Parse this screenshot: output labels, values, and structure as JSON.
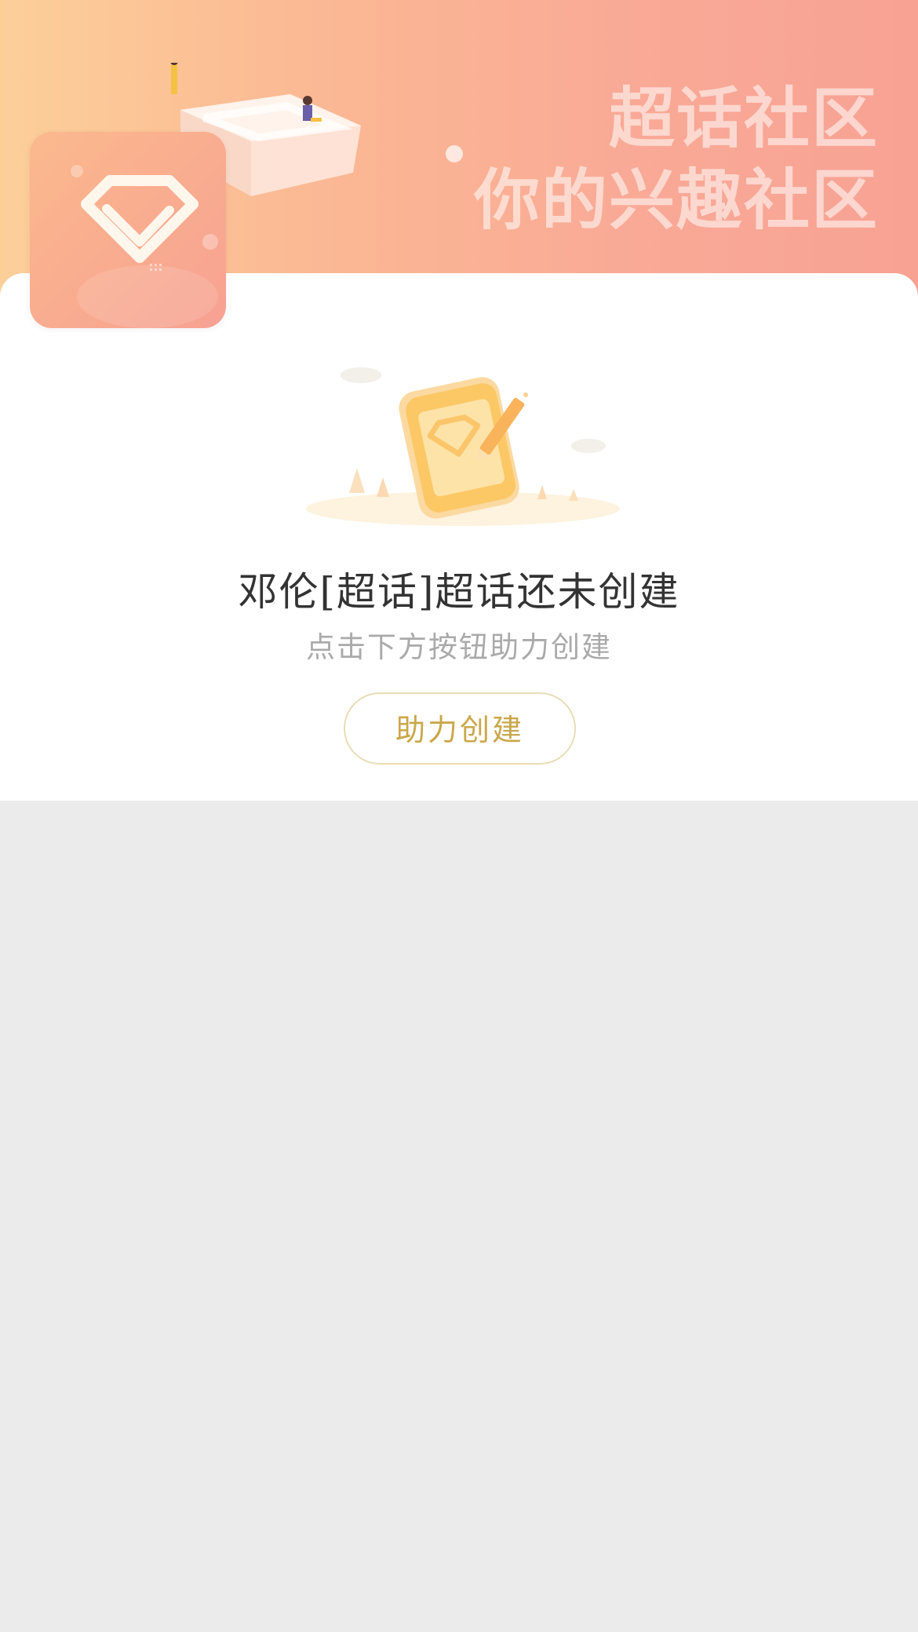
{
  "banner": {
    "slogan_line1": "超话社区",
    "slogan_line2": "你的兴趣社区"
  },
  "avatar": {
    "icon": "diamond-icon"
  },
  "empty_state": {
    "title": "邓伦[超话]超话还未创建",
    "subtitle": "点击下方按钮助力创建",
    "button_label": "助力创建",
    "illustration_icon": "diamond-notebook-pencil-icon"
  },
  "colors": {
    "banner_start": "#fccf99",
    "banner_end": "#f8a294",
    "button_text": "#c9a74a",
    "button_border": "#e9dcb5",
    "page_background": "#ebebeb"
  }
}
